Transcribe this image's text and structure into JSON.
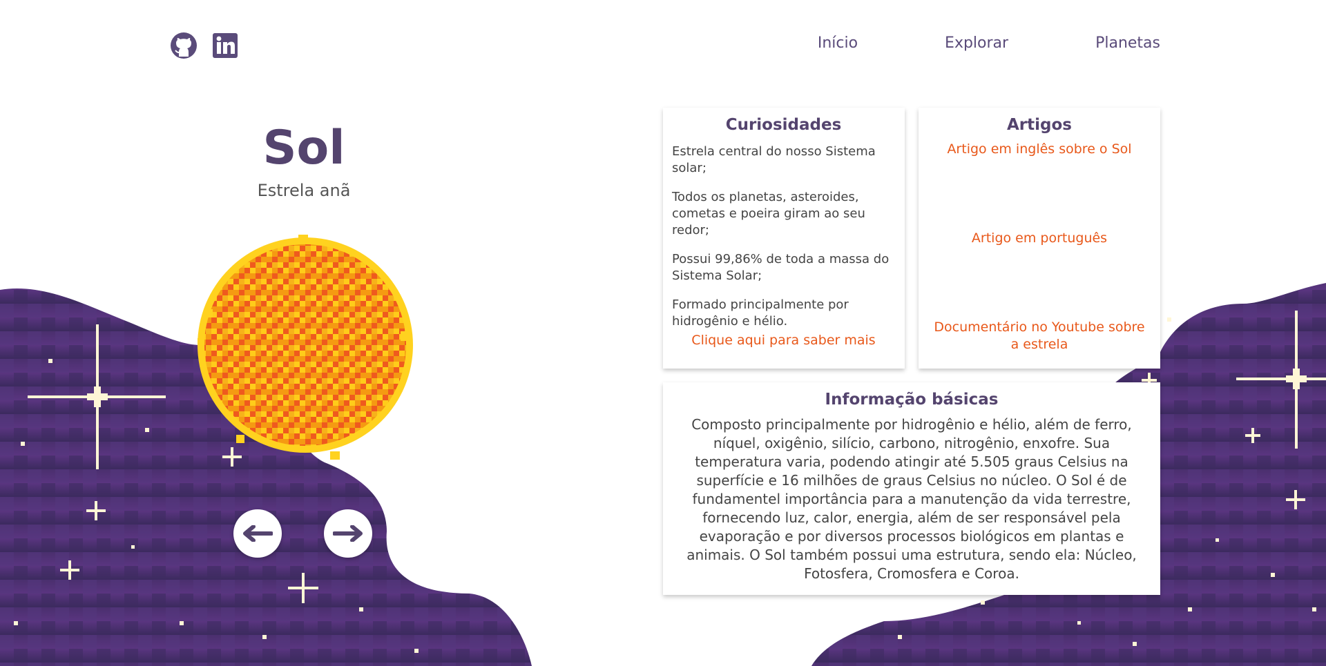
{
  "header": {
    "social": [
      {
        "name": "github-icon",
        "label": "GitHub"
      },
      {
        "name": "linkedin-icon",
        "label": "LinkedIn"
      }
    ],
    "nav": [
      "Início",
      "Explorar",
      "Planetas"
    ]
  },
  "hero": {
    "title": "Sol",
    "subtitle": "Estrela anã",
    "prev_icon": "arrow-left-icon",
    "next_icon": "arrow-right-icon"
  },
  "curiosidades": {
    "title": "Curiosidades",
    "items": [
      "Estrela central do nosso Sistema solar;",
      "Todos os planetas, asteroides, cometas e poeira giram ao seu redor;",
      "Possui 99,86% de toda a massa do Sistema Solar;",
      "Formado principalmente por hidrogênio e hélio."
    ],
    "more_link": "Clique aqui para saber mais"
  },
  "artigos": {
    "title": "Artigos",
    "links": [
      "Artigo em inglês sobre o Sol",
      "Artigo em português",
      "Documentário no Youtube sobre a estrela"
    ]
  },
  "info": {
    "title": "Informação básicas",
    "text": "Composto principalmente por hidrogênio e hélio, além de ferro, níquel, oxigênio, silício, carbono, nitrogênio, enxofre. Sua temperatura varia, podendo atingir até 5.505 graus Celsius na superfície e 16 milhões de graus Celsius no núcleo. O Sol é de fundamentel importância para a manutenção da vida terrestre, fornecendo luz, calor, energia, além de ser responsável pela evaporação e por diversos processos biológicos em plantas e animais. O Sol também possui uma estrutura, sendo ela: Núcleo, Fotosfera, Cromosfera e Coroa."
  },
  "colors": {
    "accent": "#e8581a",
    "heading": "#54446e",
    "space": "#3a2a5c"
  }
}
